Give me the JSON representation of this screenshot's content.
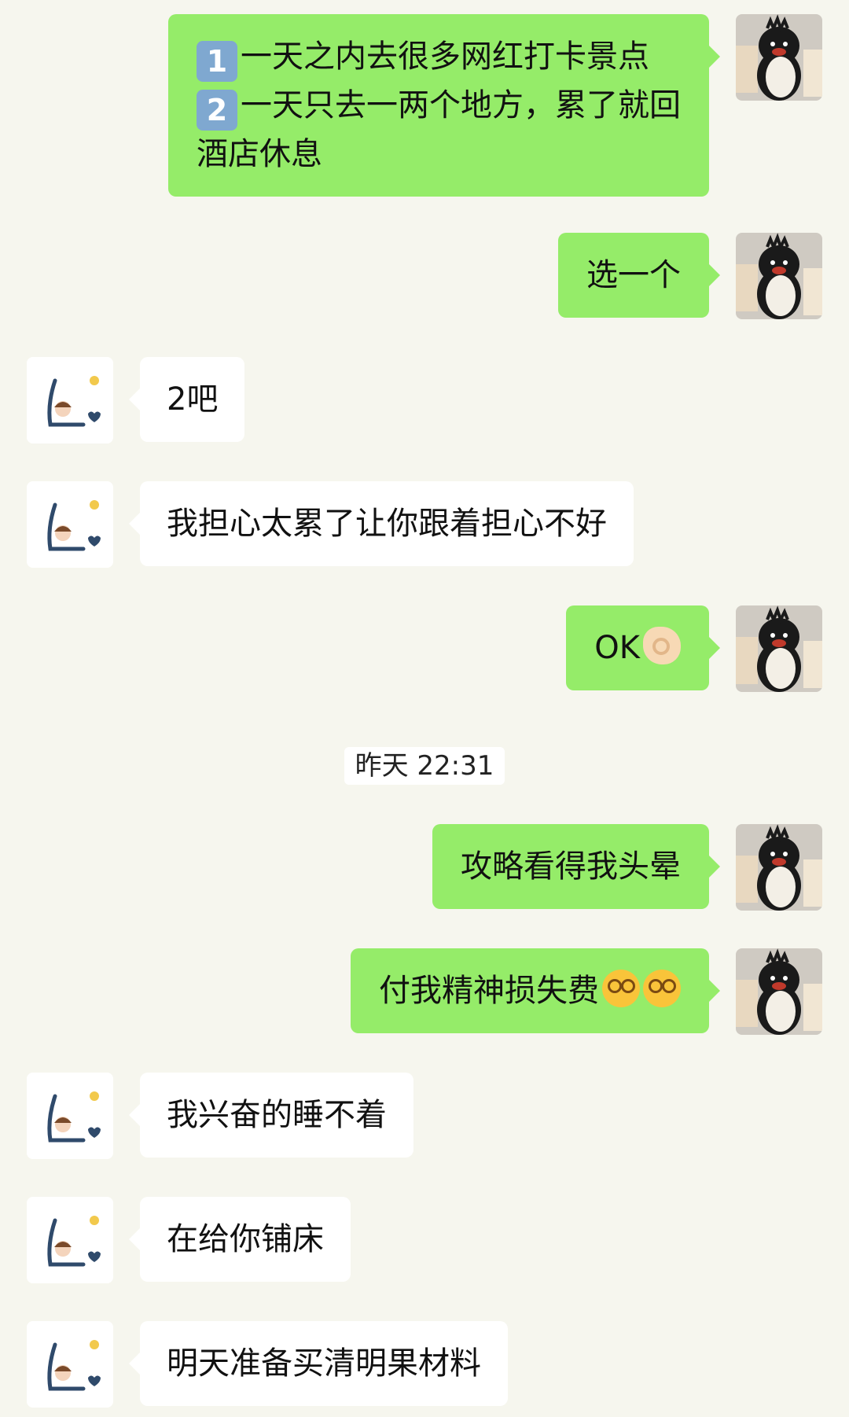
{
  "messages": [
    {
      "side": "me",
      "lines": [
        [
          {
            "keycap": "1"
          },
          {
            "text": "一天之内去很多网红打卡景点"
          }
        ],
        [
          {
            "keycap": "2"
          },
          {
            "text": "一天只去一两个地方，累了就回"
          }
        ],
        [
          {
            "text": "酒店休息"
          }
        ]
      ]
    },
    {
      "side": "me",
      "lines": [
        [
          {
            "text": "选一个"
          }
        ]
      ]
    },
    {
      "side": "them",
      "lines": [
        [
          {
            "text": "2吧"
          }
        ]
      ]
    },
    {
      "side": "them",
      "lines": [
        [
          {
            "text": "我担心太累了让你跟着担心不好"
          }
        ]
      ]
    },
    {
      "side": "me",
      "lines": [
        [
          {
            "text": "OK"
          },
          {
            "emoji": "ok-hand-emoji"
          }
        ]
      ]
    },
    {
      "type": "timestamp",
      "text": "昨天 22:31"
    },
    {
      "side": "me",
      "lines": [
        [
          {
            "text": "攻略看得我头晕"
          }
        ]
      ]
    },
    {
      "side": "me",
      "lines": [
        [
          {
            "text": "付我精神损失费"
          },
          {
            "emoji": "dizzy-face-emoji"
          },
          {
            "emoji": "dizzy-face-emoji"
          }
        ]
      ]
    },
    {
      "side": "them",
      "lines": [
        [
          {
            "text": "我兴奋的睡不着"
          }
        ]
      ]
    },
    {
      "side": "them",
      "lines": [
        [
          {
            "text": "在给你铺床"
          }
        ]
      ]
    },
    {
      "side": "them",
      "lines": [
        [
          {
            "text": "明天准备买清明果材料"
          }
        ]
      ]
    }
  ],
  "colors": {
    "background": "#F6F6EE",
    "my_bubble": "#95EC69",
    "their_bubble": "#FFFFFF"
  },
  "avatars": {
    "me": "penguin-plush-avatar",
    "them": "cartoon-girl-avatar"
  }
}
